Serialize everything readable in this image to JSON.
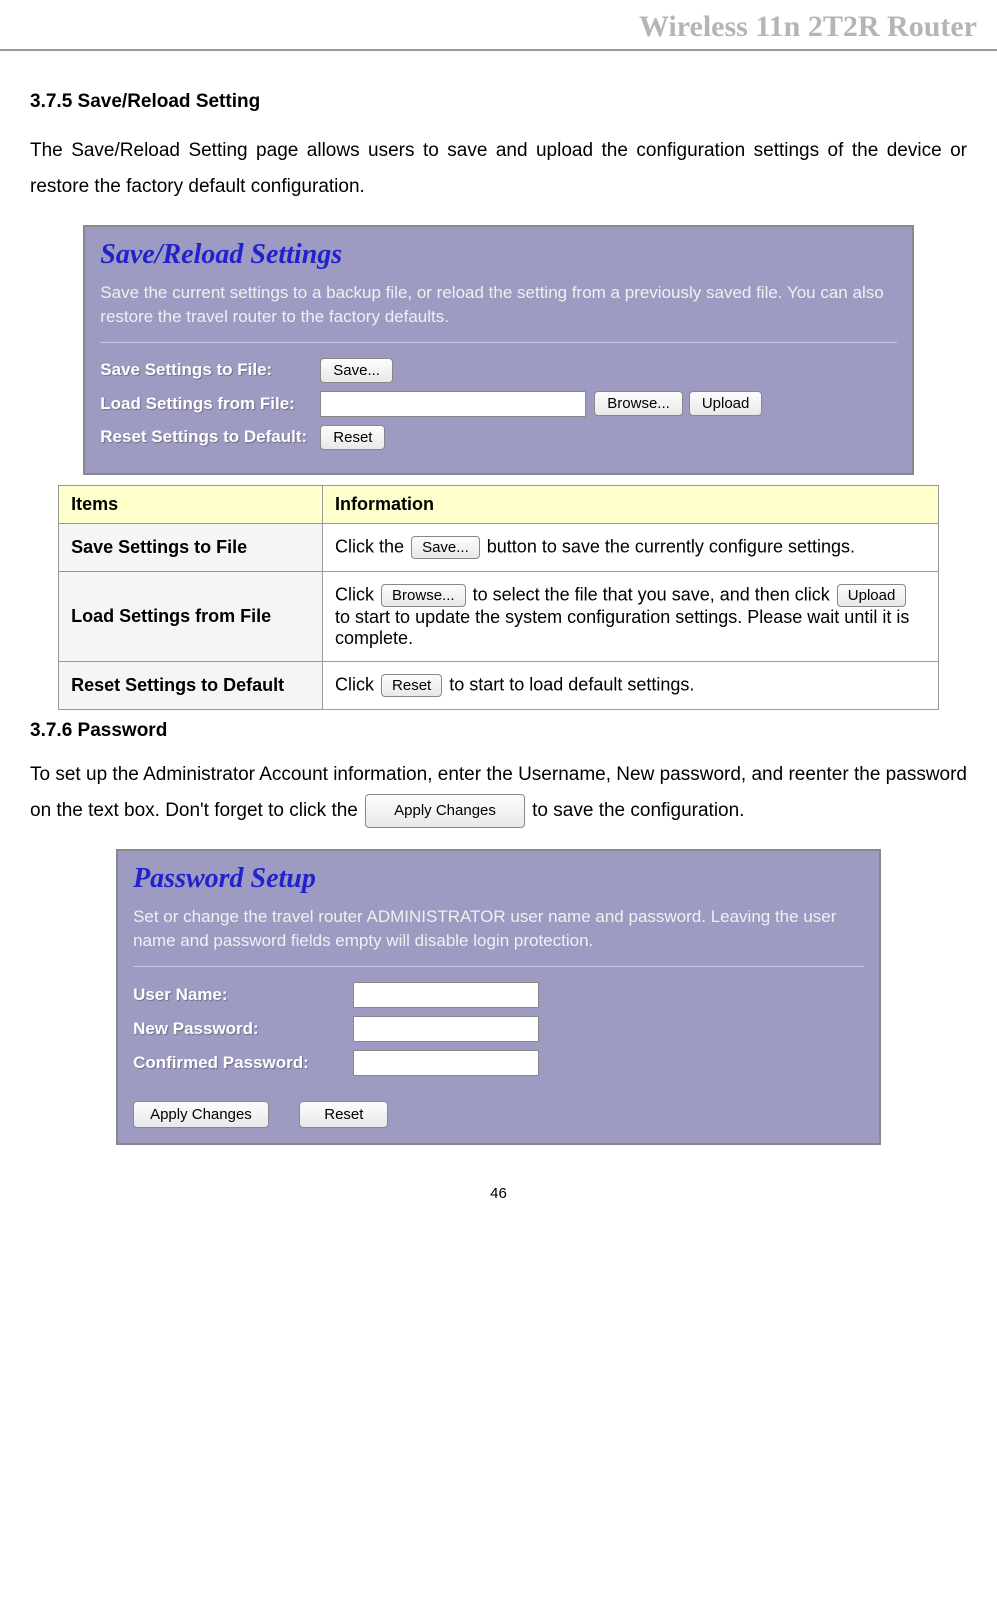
{
  "header": {
    "title": "Wireless 11n 2T2R Router"
  },
  "section1": {
    "heading": "3.7.5 Save/Reload Setting",
    "intro": "The Save/Reload Setting page allows users to save and upload the configuration settings of the device or restore the factory default configuration."
  },
  "panel1": {
    "title": "Save/Reload Settings",
    "desc": "Save the current settings to a backup file, or reload the setting from a previously saved file. You can also restore the travel router to the factory defaults.",
    "row1_label": "Save Settings to File:",
    "row1_btn": "Save...",
    "row2_label": "Load Settings from File:",
    "row2_browse": "Browse...",
    "row2_upload": "Upload",
    "row3_label": "Reset Settings to Default:",
    "row3_btn": "Reset"
  },
  "table1": {
    "h_items": "Items",
    "h_info": "Information",
    "r1_label": "Save Settings to File",
    "r1_pre": "Click the ",
    "r1_btn": "Save...",
    "r1_post": " button to save the currently configure settings.",
    "r2_label": "Load Settings from File",
    "r2_pre": "Click ",
    "r2_btn1": "Browse...",
    "r2_mid": " to select the file that you save, and then click ",
    "r2_btn2": "Upload",
    "r2_post": " to start to update the system configuration settings. Please wait until it is complete.",
    "r3_label": "Reset Settings to Default",
    "r3_pre": "Click ",
    "r3_btn": "Reset",
    "r3_post": " to start to load default settings."
  },
  "section2": {
    "heading": "3.7.6 Password",
    "intro_pre": "To set up the Administrator Account information, enter the Username, New password, and reenter the password on the text box. Don't forget to click the ",
    "intro_btn": "Apply Changes",
    "intro_post": " to save the configuration."
  },
  "panel2": {
    "title": "Password Setup",
    "desc": "Set or change the travel router ADMINISTRATOR user name and password. Leaving the user name and password fields empty will disable login protection.",
    "row1_label": "User Name:",
    "row2_label": "New Password:",
    "row3_label": "Confirmed Password:",
    "btn_apply": "Apply Changes",
    "btn_reset": "Reset"
  },
  "page_number": "46"
}
